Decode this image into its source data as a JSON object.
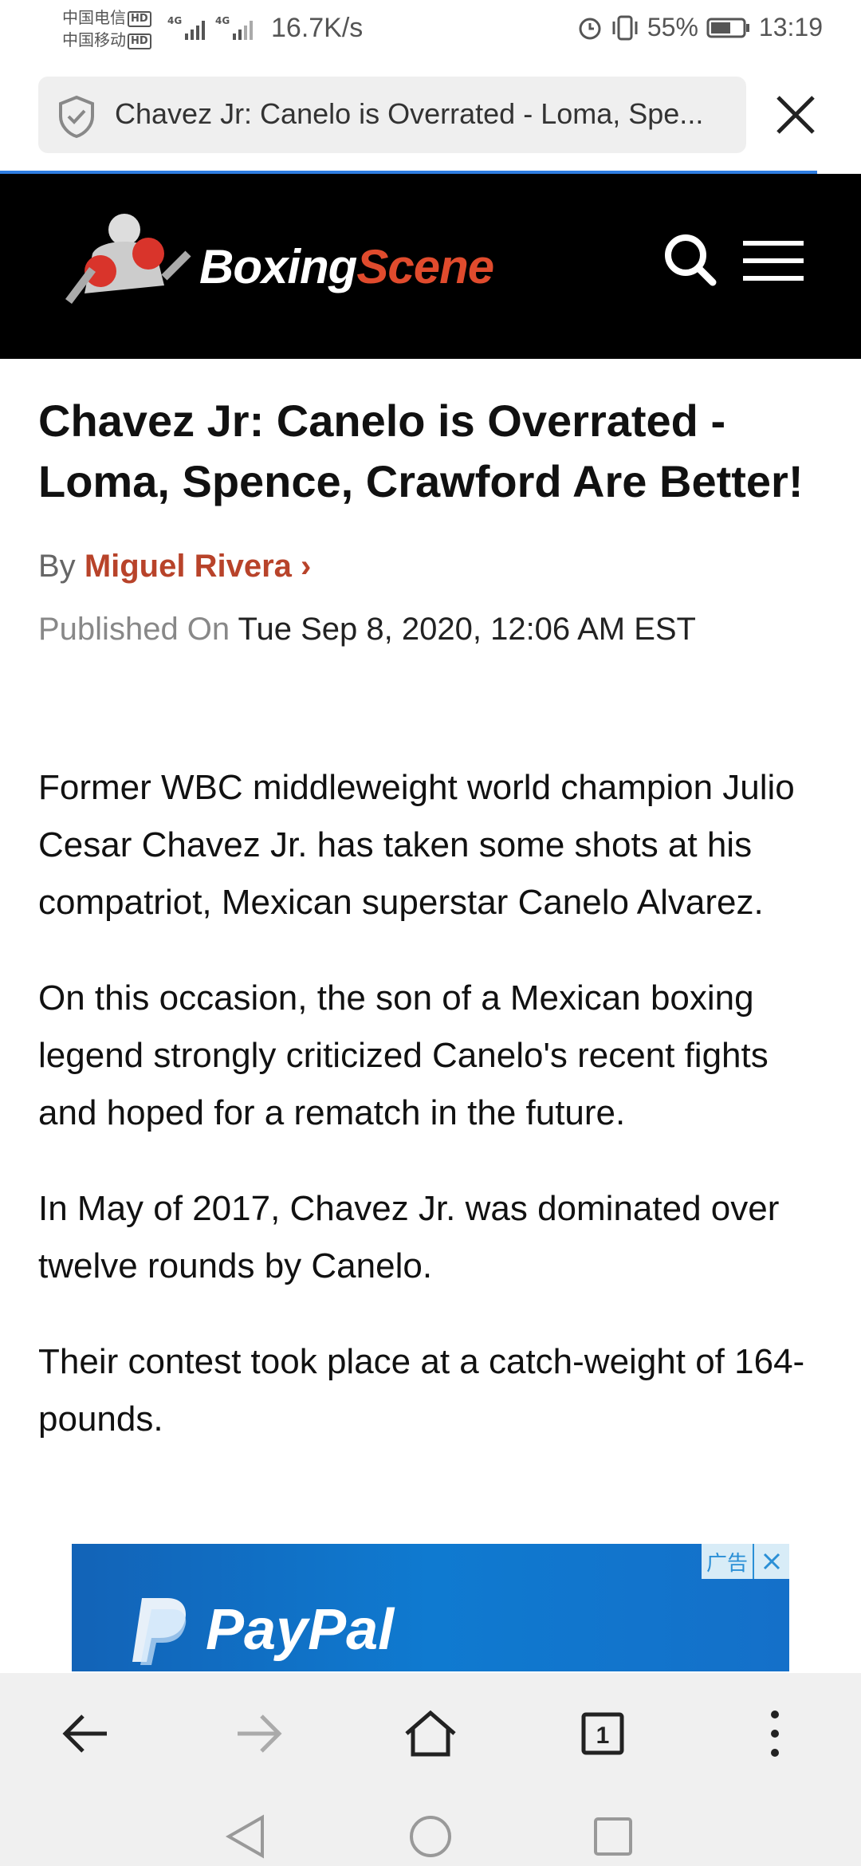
{
  "status_bar": {
    "carrier_1": "中国电信",
    "carrier_2": "中国移动",
    "hd_badge": "HD",
    "network": "4G",
    "speed": "16.7K/s",
    "battery": "55%",
    "time": "13:19"
  },
  "browser": {
    "url_title": "Chavez Jr: Canelo is Overrated - Loma, Spe...",
    "icons": [
      "shield-icon",
      "close-icon"
    ],
    "accent_color": "#2f7de1"
  },
  "site": {
    "brand_part1": "Boxing",
    "brand_part2": "Scene",
    "brand_accent": "#e04b2d",
    "icons": [
      "search-icon",
      "menu-icon"
    ]
  },
  "article": {
    "headline": "Chavez Jr: Canelo is Overrated - Loma, Spence, Crawford Are Better!",
    "by_label": "By",
    "author": "Miguel Rivera",
    "published_label": "Published On",
    "published_date": "Tue Sep 8, 2020, 12:06 AM EST",
    "paragraphs": [
      "Former WBC middleweight world champion Julio Cesar Chavez Jr. has taken some shots at his compatriot, Mexican superstar Canelo Alvarez.",
      "On this occasion, the son of a Mexican boxing legend strongly criticized Canelo's recent fights and hoped for a rematch in the future.",
      "In May of 2017, Chavez Jr. was dominated over twelve rounds by Canelo.",
      "Their contest took place at a catch-weight of 164-pounds."
    ]
  },
  "ad": {
    "label": "广告",
    "brand": "PayPal"
  },
  "browser_nav": {
    "tab_count": "1",
    "icons": [
      "back-arrow-icon",
      "forward-arrow-icon",
      "home-icon",
      "tabs-icon",
      "more-icon"
    ]
  },
  "system_nav": {
    "icons": [
      "back-triangle-icon",
      "home-circle-icon",
      "recents-square-icon"
    ]
  }
}
